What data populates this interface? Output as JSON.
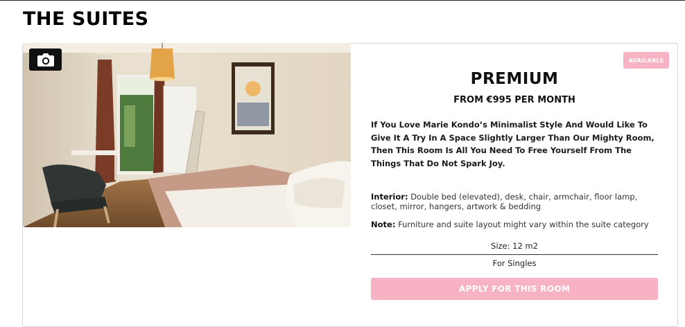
{
  "page": {
    "section_title": "THE SUITES"
  },
  "gallery": {
    "icon": "camera-icon"
  },
  "room": {
    "status_badge": "AVAILABLE",
    "name": "PREMIUM",
    "price": "FROM €995 PER MONTH",
    "description": "If You Love Marie Kondo’s Minimalist Style And Would Like To Give It A Try In A Space Slightly Larger Than Our Mighty Room, Then This Room Is All You Need To Free Yourself From The Things That Do Not Spark Joy.",
    "interior_label": "Interior:",
    "interior_text": "Double bed (elevated), desk, chair, armchair, floor lamp, closet, mirror, hangers, artwork & bedding",
    "note_label": "Note:",
    "note_text": "Furniture and suite layout might vary within the suite category",
    "size": "Size: 12 m2",
    "occupancy": "For Singles",
    "apply_label": "APPLY FOR THIS ROOM"
  },
  "colors": {
    "accent_pink": "#f7b3c4",
    "text_dark": "#111111"
  }
}
